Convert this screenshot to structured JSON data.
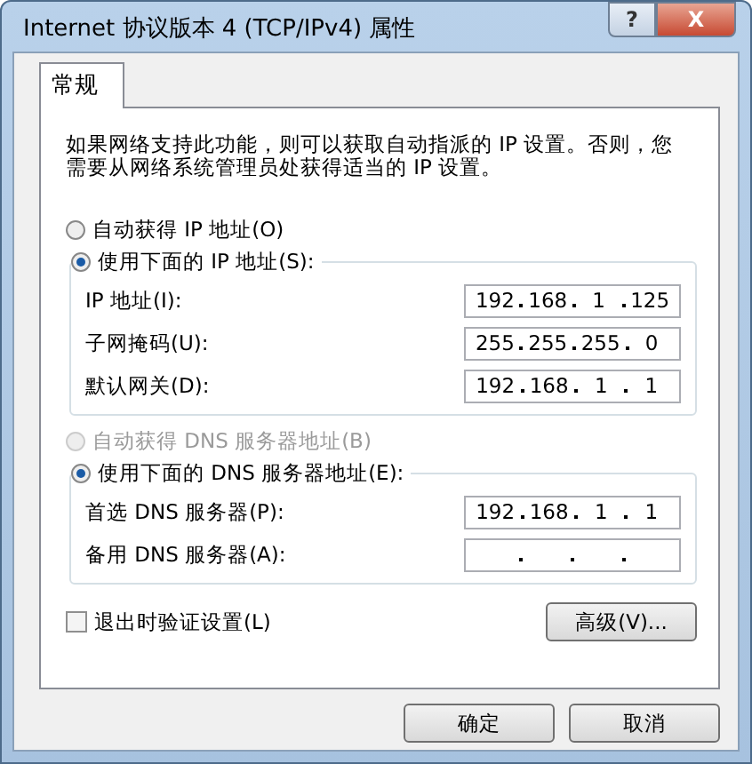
{
  "window": {
    "title": "Internet 协议版本 4 (TCP/IPv4) 属性",
    "help": "?",
    "close": "X"
  },
  "tabs": [
    {
      "label": "常规",
      "selected": true
    }
  ],
  "intro": "如果网络支持此功能，则可以获取自动指派的 IP 设置。否则，您需要从网络系统管理员处获得适当的 IP 设置。",
  "groups": [
    {
      "auto": {
        "label": "自动获得 IP 地址(O)",
        "selected": false,
        "disabled": false
      },
      "manual": {
        "label": "使用下面的 IP 地址(S):",
        "selected": true,
        "disabled": false
      },
      "fields": [
        {
          "label": "IP 地址(I):",
          "octets": [
            "192",
            "168",
            "1",
            "125"
          ]
        },
        {
          "label": "子网掩码(U):",
          "octets": [
            "255",
            "255",
            "255",
            "0"
          ]
        },
        {
          "label": "默认网关(D):",
          "octets": [
            "192",
            "168",
            "1",
            "1"
          ]
        }
      ]
    },
    {
      "auto": {
        "label": "自动获得 DNS 服务器地址(B)",
        "selected": false,
        "disabled": true
      },
      "manual": {
        "label": "使用下面的 DNS 服务器地址(E):",
        "selected": true,
        "disabled": false
      },
      "fields": [
        {
          "label": "首选 DNS 服务器(P):",
          "octets": [
            "192",
            "168",
            "1",
            "1"
          ]
        },
        {
          "label": "备用 DNS 服务器(A):"
        }
      ]
    }
  ],
  "validate": {
    "label": "退出时验证设置(L)",
    "checked": false
  },
  "advanced": "高级(V)...",
  "buttons": [
    "确定",
    "取消"
  ]
}
